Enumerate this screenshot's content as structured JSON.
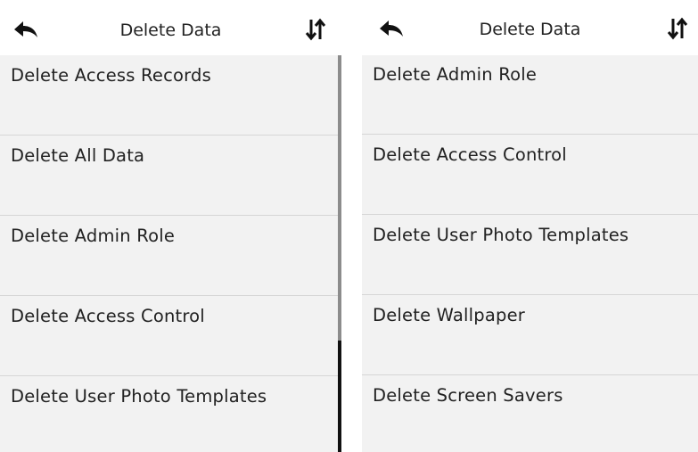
{
  "screens": [
    {
      "header": {
        "title": "Delete Data",
        "back_icon": "back-arrow-icon",
        "sort_icon": "sort-arrows-icon"
      },
      "items": [
        {
          "label": "Delete Access Records"
        },
        {
          "label": "Delete All Data"
        },
        {
          "label": "Delete Admin Role"
        },
        {
          "label": "Delete Access Control"
        },
        {
          "label": "Delete User Photo Templates"
        }
      ]
    },
    {
      "header": {
        "title": "Delete Data",
        "back_icon": "back-arrow-icon",
        "sort_icon": "sort-arrows-icon"
      },
      "items": [
        {
          "label": "Delete Admin Role"
        },
        {
          "label": "Delete Access Control"
        },
        {
          "label": "Delete User Photo Templates"
        },
        {
          "label": "Delete Wallpaper"
        },
        {
          "label": "Delete Screen Savers"
        }
      ]
    }
  ],
  "colors": {
    "header_bg": "#ffffff",
    "list_bg": "#f2f2f2",
    "divider": "#d6d6d6",
    "text": "#222222"
  }
}
